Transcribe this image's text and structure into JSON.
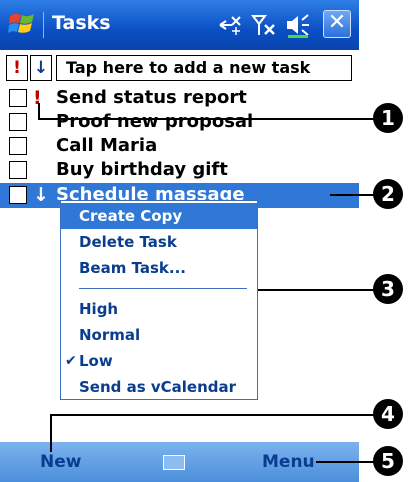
{
  "titlebar": {
    "title": "Tasks",
    "close_label": "✕"
  },
  "new_task": {
    "high_priority_label": "!",
    "low_priority_label": "↓",
    "placeholder": "Tap here to add a new task"
  },
  "tasks": [
    {
      "label": "Send status report",
      "priority": "high",
      "priority_glyph": "!"
    },
    {
      "label": "Proof new proposal",
      "priority": "normal",
      "priority_glyph": ""
    },
    {
      "label": "Call Maria",
      "priority": "normal",
      "priority_glyph": ""
    },
    {
      "label": "Buy birthday gift",
      "priority": "normal",
      "priority_glyph": ""
    },
    {
      "label": "Schedule massage",
      "priority": "low",
      "priority_glyph": "↓",
      "selected": true
    }
  ],
  "context_menu": {
    "items": [
      "Create Copy",
      "Delete Task",
      "Beam Task...",
      "High",
      "Normal",
      "Low",
      "Send as vCalendar"
    ],
    "checked_item": "Low",
    "check_glyph": "✔"
  },
  "bottombar": {
    "left_label": "New",
    "right_label": "Menu"
  },
  "callouts": [
    "1",
    "2",
    "3",
    "4",
    "5"
  ],
  "colors": {
    "titlebar": "#0b4fc4",
    "selection": "#2f78d8",
    "high_priority": "#c00000",
    "low_priority": "#0b3d8f",
    "menu_text": "#0b3d8f"
  }
}
